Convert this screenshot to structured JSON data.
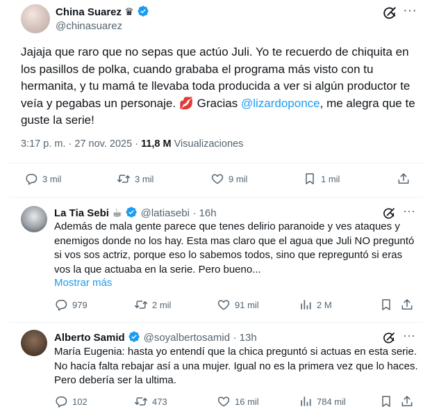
{
  "main_tweet": {
    "author": "China Suarez",
    "author_emoji": "♛",
    "handle": "@chinasuarez",
    "text_before_mention": "Jajaja que raro que no sepas que actúo Juli. Yo te recuerdo de chiquita en los pasillos de polka, cuando grababa el programa más visto con tu hermanita, y tu mamá te llevaba toda producida a ver si algún productor te veía y pegabas un personaje. 💋 Gracias ",
    "mention": "@lizardoponce",
    "text_after_mention": ", me alegra que te guste la serie!",
    "time": "3:17 p. m.",
    "sep": "·",
    "date": "27 nov. 2025",
    "views": "11,8 M",
    "views_label": "Visualizaciones",
    "replies": "3 mil",
    "reposts": "3 mil",
    "likes": "9 mil",
    "bookmarks": "1 mil"
  },
  "replies": [
    {
      "author": "La Tia Sebi",
      "author_emoji": "☕",
      "handle": "@latiasebi",
      "time": "· 16h",
      "text": "Además de mala gente parece que tenes  delirio paranoide y ves ataques y enemigos donde no los hay. Esta mas claro que el agua que Juli NO preguntó si vos sos actriz, porque eso lo sabemos todos, sino que repreguntó si eras vos la que actuaba en la serie.  Pero bueno...",
      "show_more": "Mostrar más",
      "replies": "979",
      "reposts": "2 mil",
      "likes": "91 mil",
      "views": "2 M"
    },
    {
      "author": "Alberto Samid",
      "handle": "@soyalbertosamid",
      "time": "· 13h",
      "text": "María Eugenia: hasta yo entendí que la chica preguntó si actuas en esta serie. No hacía falta rebajar así a una mujer. Igual no es la primera vez que lo haces. Pero debería ser la ultima.",
      "replies": "102",
      "reposts": "473",
      "likes": "16 mil",
      "views": "784 mil"
    }
  ],
  "icons": {
    "verified": "verified-badge-icon",
    "grok": "grok-icon",
    "more": "more-icon",
    "reply": "reply-icon",
    "repost": "repost-icon",
    "like": "like-icon",
    "views": "views-icon",
    "bookmark": "bookmark-icon",
    "share": "share-icon"
  },
  "colors": {
    "text": "#0f1419",
    "muted": "#536471",
    "link": "#1d9bf0",
    "verified": "#1d9bf0",
    "divider": "#eff3f4"
  }
}
